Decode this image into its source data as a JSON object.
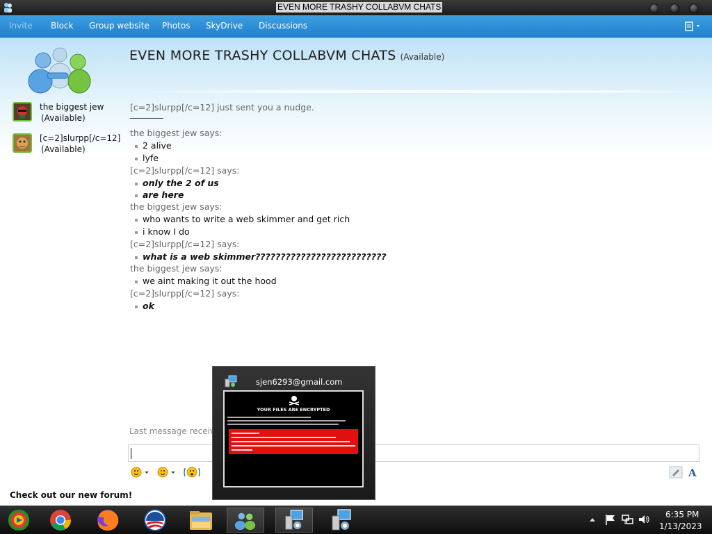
{
  "window": {
    "title": "EVEN MORE TRASHY COLLABVM CHATS"
  },
  "menu": {
    "items": [
      "Invite",
      "Block",
      "Group website",
      "Photos",
      "SkyDrive",
      "Discussions"
    ]
  },
  "conversation": {
    "title": "EVEN MORE TRASHY COLLABVM CHATS",
    "status": "(Available)"
  },
  "contacts": [
    {
      "name": "the biggest jew",
      "status": "(Available)"
    },
    {
      "name": "[c=2]slurpp[/c=12]",
      "status": "(Available)"
    }
  ],
  "nudge": "[c=2]slurpp[/c=12] just sent you a nudge.",
  "messages": [
    {
      "header": "the biggest jew says:",
      "styled": false,
      "lines": [
        "2 alive",
        "lyfe"
      ]
    },
    {
      "header": "[c=2]slurpp[/c=12] says:",
      "styled": true,
      "lines": [
        "only the 2 of us",
        "are here"
      ]
    },
    {
      "header": "the biggest jew says:",
      "styled": false,
      "lines": [
        "who wants to write a web skimmer and get rich",
        "i know I do"
      ]
    },
    {
      "header": "[c=2]slurpp[/c=12] says:",
      "styled": true,
      "lines": [
        "what is a web skimmer??????????????????????????"
      ]
    },
    {
      "header": "the biggest jew says:",
      "styled": false,
      "lines": [
        "we aint making it out the hood"
      ]
    },
    {
      "header": "[c=2]slurpp[/c=12] says:",
      "styled": true,
      "lines": [
        "ok"
      ]
    }
  ],
  "footer": {
    "last_message": "Last message receive",
    "forum_link": "Check out our new forum!"
  },
  "popup": {
    "title": "sjen6293@gmail.com",
    "preview_heading": "YOUR FILES ARE ENCRYPTED"
  },
  "taskbar": {
    "apps": [
      "windows-media-center-icon",
      "chrome-icon",
      "firefox-icon",
      "obama-icon",
      "file-explorer-icon",
      "messenger-icon",
      "remote-tool-icon",
      "remote-tool-icon"
    ],
    "time": "6:35 PM",
    "date": "1/13/2023"
  },
  "colors": {
    "menubar": "#2a8fd6",
    "titlebar": "#2a2a2a",
    "taskbar": "#1a1a1a",
    "contact_border": "#6dc23f"
  }
}
